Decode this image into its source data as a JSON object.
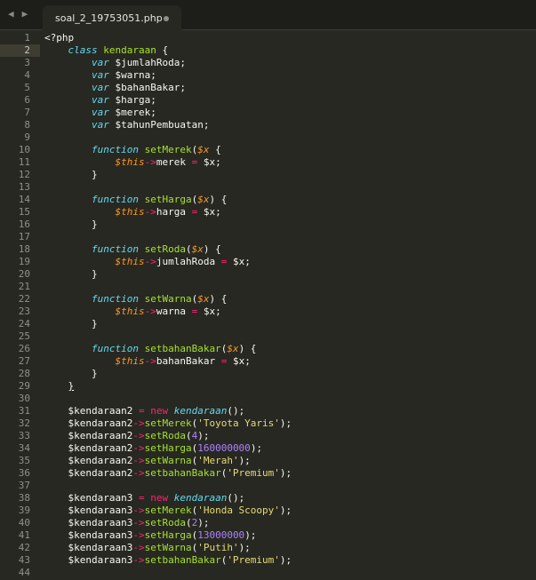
{
  "tab": {
    "filename": "soal_2_19753051.php"
  },
  "nav": {
    "back": "◀",
    "forward": "▶"
  },
  "line_numbers": [
    "1",
    "2",
    "3",
    "4",
    "5",
    "6",
    "7",
    "8",
    "9",
    "10",
    "11",
    "12",
    "13",
    "14",
    "15",
    "16",
    "17",
    "18",
    "19",
    "20",
    "21",
    "22",
    "23",
    "24",
    "25",
    "26",
    "27",
    "28",
    "29",
    "30",
    "31",
    "32",
    "33",
    "34",
    "35",
    "36",
    "37",
    "38",
    "39",
    "40",
    "41",
    "42",
    "43",
    "44"
  ],
  "active_line": 2,
  "code": [
    [
      [
        "",
        "<?php"
      ]
    ],
    [
      [
        "",
        "    "
      ],
      [
        "k",
        "class"
      ],
      [
        "",
        ""
      ],
      [
        "n",
        " kendaraan"
      ],
      [
        "",
        " {"
      ]
    ],
    [
      [
        "",
        "        "
      ],
      [
        "k",
        "var"
      ],
      [
        "",
        " $jumlahRoda;"
      ]
    ],
    [
      [
        "",
        "        "
      ],
      [
        "k",
        "var"
      ],
      [
        "",
        " $warna;"
      ]
    ],
    [
      [
        "",
        "        "
      ],
      [
        "k",
        "var"
      ],
      [
        "",
        " $bahanBakar;"
      ]
    ],
    [
      [
        "",
        "        "
      ],
      [
        "k",
        "var"
      ],
      [
        "",
        " $harga;"
      ]
    ],
    [
      [
        "",
        "        "
      ],
      [
        "k",
        "var"
      ],
      [
        "",
        " $merek;"
      ]
    ],
    [
      [
        "",
        "        "
      ],
      [
        "k",
        "var"
      ],
      [
        "",
        " $tahunPembuatan;"
      ]
    ],
    [
      [
        "",
        ""
      ]
    ],
    [
      [
        "",
        "        "
      ],
      [
        "k",
        "function"
      ],
      [
        "n",
        " setMerek"
      ],
      [
        "",
        "("
      ],
      [
        "p",
        "$x"
      ],
      [
        "",
        " {"
      ]
    ],
    [
      [
        "",
        "            "
      ],
      [
        "t",
        "$this"
      ],
      [
        "o",
        "->"
      ],
      [
        "",
        "merek "
      ],
      [
        "o",
        "="
      ],
      [
        "",
        " $x;"
      ]
    ],
    [
      [
        "",
        "        }"
      ]
    ],
    [
      [
        "",
        ""
      ]
    ],
    [
      [
        "",
        "        "
      ],
      [
        "k",
        "function"
      ],
      [
        "n",
        " setHarga"
      ],
      [
        "",
        "("
      ],
      [
        "p",
        "$x"
      ],
      [
        "",
        ") {"
      ]
    ],
    [
      [
        "",
        "            "
      ],
      [
        "t",
        "$this"
      ],
      [
        "o",
        "->"
      ],
      [
        "",
        "harga "
      ],
      [
        "o",
        "="
      ],
      [
        "",
        " $x;"
      ]
    ],
    [
      [
        "",
        "        }"
      ]
    ],
    [
      [
        "",
        ""
      ]
    ],
    [
      [
        "",
        "        "
      ],
      [
        "k",
        "function"
      ],
      [
        "n",
        " setRoda"
      ],
      [
        "",
        "("
      ],
      [
        "p",
        "$x"
      ],
      [
        "",
        ") {"
      ]
    ],
    [
      [
        "",
        "            "
      ],
      [
        "t",
        "$this"
      ],
      [
        "o",
        "->"
      ],
      [
        "",
        "jumlahRoda "
      ],
      [
        "o",
        "="
      ],
      [
        "",
        " $x;"
      ]
    ],
    [
      [
        "",
        "        }"
      ]
    ],
    [
      [
        "",
        ""
      ]
    ],
    [
      [
        "",
        "        "
      ],
      [
        "k",
        "function"
      ],
      [
        "n",
        " setWarna"
      ],
      [
        "",
        "("
      ],
      [
        "p",
        "$x"
      ],
      [
        "",
        ") {"
      ]
    ],
    [
      [
        "",
        "            "
      ],
      [
        "t",
        "$this"
      ],
      [
        "o",
        "->"
      ],
      [
        "",
        "warna "
      ],
      [
        "o",
        "="
      ],
      [
        "",
        " $x;"
      ]
    ],
    [
      [
        "",
        "        }"
      ]
    ],
    [
      [
        "",
        ""
      ]
    ],
    [
      [
        "",
        "        "
      ],
      [
        "k",
        "function"
      ],
      [
        "n",
        " setbahanBakar"
      ],
      [
        "",
        "("
      ],
      [
        "p",
        "$x"
      ],
      [
        "",
        ") {"
      ]
    ],
    [
      [
        "",
        "            "
      ],
      [
        "t",
        "$this"
      ],
      [
        "o",
        "->"
      ],
      [
        "",
        "bahanBakar "
      ],
      [
        "o",
        "="
      ],
      [
        "",
        " $x;"
      ]
    ],
    [
      [
        "",
        "        }"
      ]
    ],
    [
      [
        "",
        "    "
      ],
      [
        "cu",
        "}"
      ]
    ],
    [
      [
        "",
        ""
      ]
    ],
    [
      [
        "",
        "    $kendaraan2 "
      ],
      [
        "o",
        "="
      ],
      [
        "",
        " "
      ],
      [
        "o",
        "new"
      ],
      [
        "",
        " "
      ],
      [
        "k",
        "kendaraan"
      ],
      [
        "",
        "();"
      ]
    ],
    [
      [
        "",
        "    $kendaraan2"
      ],
      [
        "o",
        "->"
      ],
      [
        "n",
        "setMerek"
      ],
      [
        "",
        "("
      ],
      [
        "s",
        "'Toyota Yaris'"
      ],
      [
        "",
        ");"
      ]
    ],
    [
      [
        "",
        "    $kendaraan2"
      ],
      [
        "o",
        "->"
      ],
      [
        "n",
        "setRoda"
      ],
      [
        "",
        "("
      ],
      [
        "num",
        "4"
      ],
      [
        "",
        ");"
      ]
    ],
    [
      [
        "",
        "    $kendaraan2"
      ],
      [
        "o",
        "->"
      ],
      [
        "n",
        "setHarga"
      ],
      [
        "",
        "("
      ],
      [
        "num",
        "160000000"
      ],
      [
        "",
        ");"
      ]
    ],
    [
      [
        "",
        "    $kendaraan2"
      ],
      [
        "o",
        "->"
      ],
      [
        "n",
        "setWarna"
      ],
      [
        "",
        "("
      ],
      [
        "s",
        "'Merah'"
      ],
      [
        "",
        ");"
      ]
    ],
    [
      [
        "",
        "    $kendaraan2"
      ],
      [
        "o",
        "->"
      ],
      [
        "n",
        "setbahanBakar"
      ],
      [
        "",
        "("
      ],
      [
        "s",
        "'Premium'"
      ],
      [
        "",
        ");"
      ]
    ],
    [
      [
        "",
        ""
      ]
    ],
    [
      [
        "",
        "    $kendaraan3 "
      ],
      [
        "o",
        "="
      ],
      [
        "",
        " "
      ],
      [
        "o",
        "new"
      ],
      [
        "",
        " "
      ],
      [
        "k",
        "kendaraan"
      ],
      [
        "",
        "();"
      ]
    ],
    [
      [
        "",
        "    $kendaraan3"
      ],
      [
        "o",
        "->"
      ],
      [
        "n",
        "setMerek"
      ],
      [
        "",
        "("
      ],
      [
        "s",
        "'Honda Scoopy'"
      ],
      [
        "",
        ");"
      ]
    ],
    [
      [
        "",
        "    $kendaraan3"
      ],
      [
        "o",
        "->"
      ],
      [
        "n",
        "setRoda"
      ],
      [
        "",
        "("
      ],
      [
        "num",
        "2"
      ],
      [
        "",
        ");"
      ]
    ],
    [
      [
        "",
        "    $kendaraan3"
      ],
      [
        "o",
        "->"
      ],
      [
        "n",
        "setHarga"
      ],
      [
        "",
        "("
      ],
      [
        "num",
        "13000000"
      ],
      [
        "",
        ");"
      ]
    ],
    [
      [
        "",
        "    $kendaraan3"
      ],
      [
        "o",
        "->"
      ],
      [
        "n",
        "setWarna"
      ],
      [
        "",
        "("
      ],
      [
        "s",
        "'Putih'"
      ],
      [
        "",
        ");"
      ]
    ],
    [
      [
        "",
        "    $kendaraan3"
      ],
      [
        "o",
        "->"
      ],
      [
        "n",
        "setbahanBakar"
      ],
      [
        "",
        "("
      ],
      [
        "s",
        "'Premium'"
      ],
      [
        "",
        ");"
      ]
    ],
    [
      [
        "",
        ""
      ]
    ]
  ]
}
